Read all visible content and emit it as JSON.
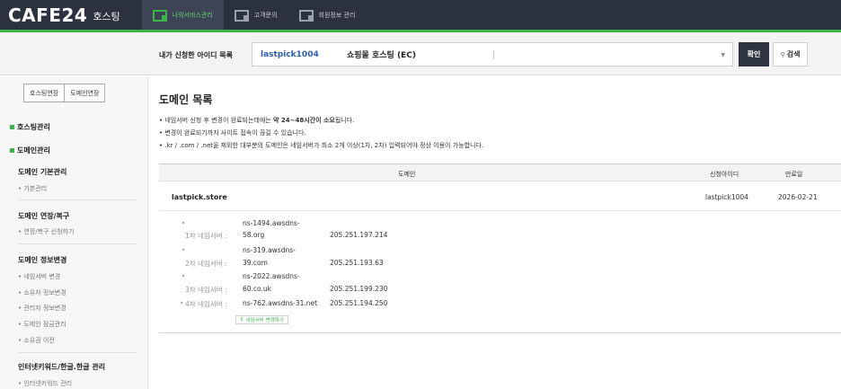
{
  "brand": {
    "logo": "CAFE24",
    "sub": "호스팅"
  },
  "nav": [
    {
      "label": "나의서비스관리",
      "active": true
    },
    {
      "label": "고객문의",
      "active": false
    },
    {
      "label": "회원정보 관리",
      "active": false
    }
  ],
  "account_bar": {
    "label": "내가 신청한 아이디 목록",
    "selected_id": "lastpick1004",
    "selected_type": "쇼핑몰 호스팅 (EC)",
    "confirm": "확인",
    "search": "검색"
  },
  "sidebar": {
    "buttons": [
      "호스팅연장",
      "도메인연장"
    ],
    "cat1": "호스팅관리",
    "cat2": "도메인관리",
    "groups": [
      {
        "title": "도메인 기본관리",
        "items": [
          "기본관리"
        ]
      },
      {
        "title": "도메인 연장/복구",
        "items": [
          "연장/복구 신청하기"
        ]
      },
      {
        "title": "도메인 정보변경",
        "items": [
          "네임서버 변경",
          "소유자 정보변경",
          "관리자 정보변경",
          "도메인 잠금관리",
          "소유권 이전"
        ]
      },
      {
        "title": "인터넷키워드/한글.한글 관리",
        "items": [
          "인터넷키워드 관리"
        ]
      }
    ]
  },
  "main": {
    "title": "도메인 목록",
    "notes": [
      {
        "pre": "• 네임서버 신청 후 변경이 완료되는데에는 ",
        "bold": "약 24~48시간이 소요",
        "post": "됩니다."
      },
      {
        "pre": "• 변경이 완료되기까지 사이트 접속이 끊길 수 있습니다.",
        "bold": "",
        "post": ""
      },
      {
        "pre": "• .kr / .com / .net을 제외한 대부분의 도메인은 네임서버가 최소 2개 이상(1차, 2차) 입력되어야 정상 이용이 가능합니다.",
        "bold": "",
        "post": ""
      }
    ],
    "table": {
      "headers": [
        "도메인",
        "신청아이디",
        "만료일"
      ],
      "row": {
        "domain": "lastpick.store",
        "id": "lastpick1004",
        "expiry": "2026-02-21"
      }
    },
    "nameservers": [
      {
        "label": "1차 네임서버 :",
        "host1": "ns-1494.awsdns-",
        "host2": "58.org",
        "ip": "205.251.197.214"
      },
      {
        "label": "2차 네임서버 :",
        "host1": "ns-319.awsdns-",
        "host2": "39.com",
        "ip": "205.251.193.63"
      },
      {
        "label": "3차 네임서버 :",
        "host1": "ns-2022.awsdns-",
        "host2": "60.co.uk",
        "ip": "205.251.199.230"
      },
      {
        "label": "4차 네임서버 :",
        "host1": "ns-762.awsdns-31.net",
        "host2": "",
        "ip": "205.251.194.250"
      }
    ],
    "ns_change_button": "네임서버 변경하기"
  },
  "colors": {
    "topbar": "#2c3140",
    "accent": "#39b54a",
    "link": "#2a5db0"
  }
}
